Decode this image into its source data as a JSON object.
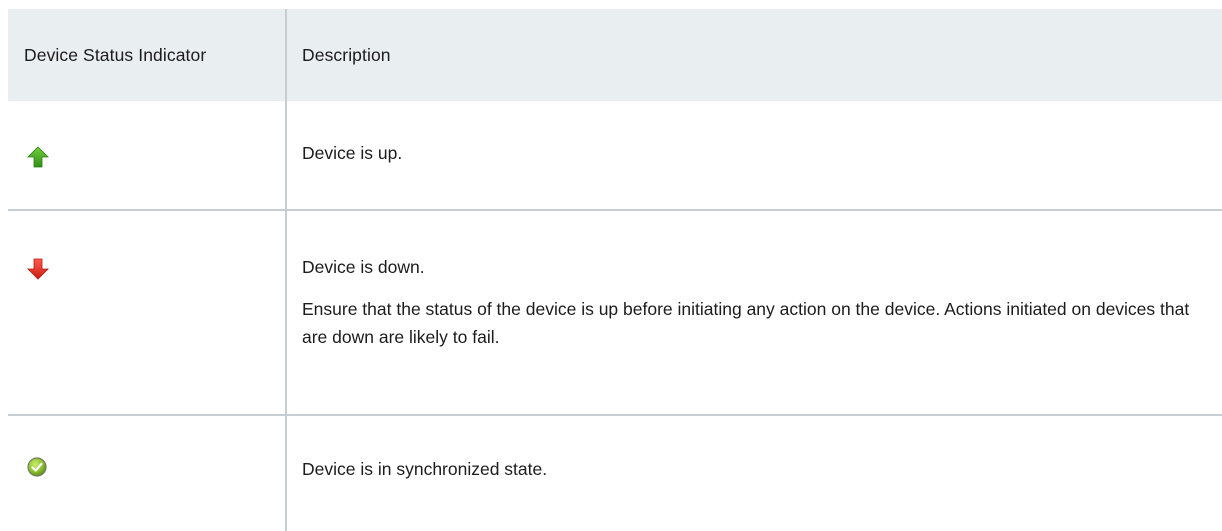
{
  "table": {
    "headers": {
      "indicator": "Device Status Indicator",
      "description": "Description"
    },
    "rows": [
      {
        "icon": "green-up-arrow-icon",
        "status": "up",
        "color": "#4caf28",
        "description": [
          "Device is up."
        ]
      },
      {
        "icon": "red-down-arrow-icon",
        "status": "down",
        "color": "#e8302a",
        "description": [
          "Device is down.",
          "Ensure that the status of the device is up before initiating any action on the device. Actions initiated on devices that are down are likely to fail."
        ]
      },
      {
        "icon": "green-check-circle-icon",
        "status": "synchronized",
        "color": "#8bbf2a",
        "description": [
          "Device is in synchronized state."
        ]
      }
    ]
  }
}
